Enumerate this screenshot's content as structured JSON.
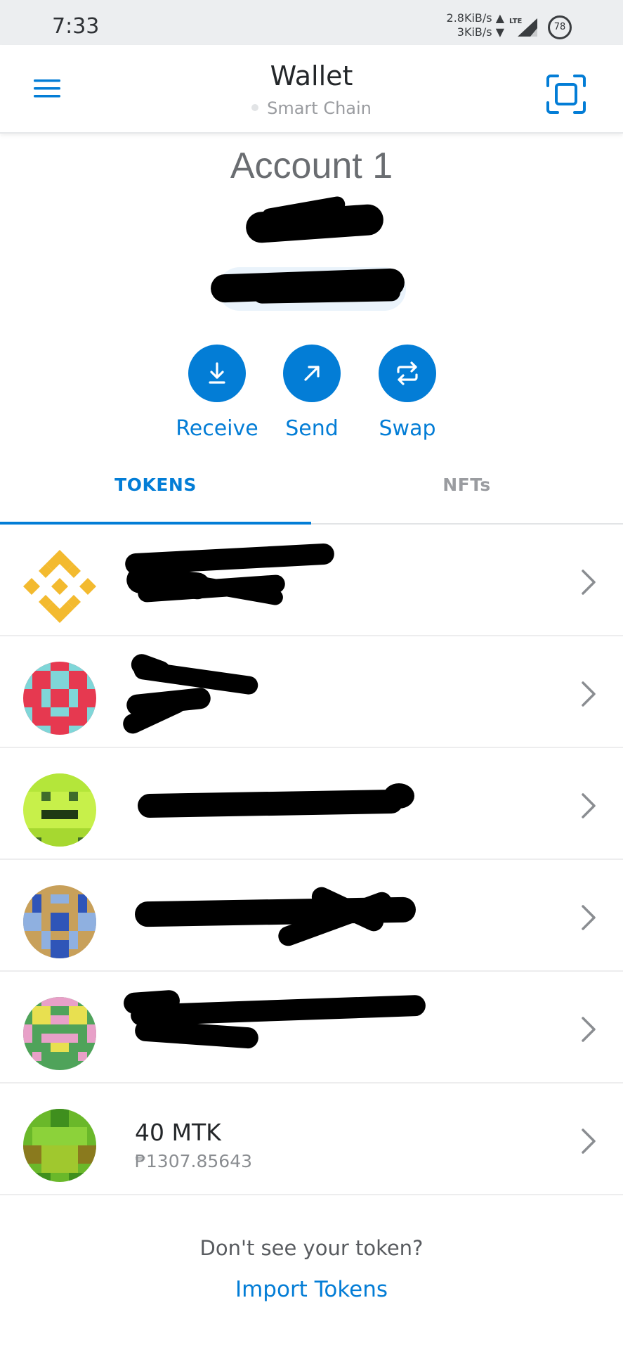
{
  "status_bar": {
    "time": "7:33",
    "upload_speed": "2.8KiB/s",
    "download_speed": "3KiB/s",
    "network_type": "LTE",
    "battery_level": "78"
  },
  "header": {
    "title": "Wallet",
    "network": "Smart Chain",
    "menu_icon": "hamburger-menu-icon",
    "scan_icon": "qr-scan-icon"
  },
  "account": {
    "name": "Account 1"
  },
  "actions": [
    {
      "label": "Receive",
      "icon": "download-arrow-icon"
    },
    {
      "label": "Send",
      "icon": "diagonal-arrow-icon"
    },
    {
      "label": "Swap",
      "icon": "swap-arrows-icon"
    }
  ],
  "tabs": [
    {
      "label": "TOKENS",
      "active": true
    },
    {
      "label": "NFTs",
      "active": false
    }
  ],
  "tokens": [
    {
      "amount": "",
      "fiat": "",
      "icon": "bnb-logo-icon"
    },
    {
      "amount": "",
      "fiat": "",
      "icon": "identicon-red-cyan"
    },
    {
      "amount": "",
      "fiat": "",
      "icon": "identicon-lime-smiley"
    },
    {
      "amount": "",
      "fiat": "",
      "icon": "identicon-blue-tan"
    },
    {
      "amount": "",
      "fiat": "",
      "icon": "identicon-green-pink"
    },
    {
      "amount": "40 MTK",
      "fiat": "₱1307.85643",
      "icon": "identicon-green-olive"
    }
  ],
  "footer": {
    "prompt": "Don't see your token?",
    "link": "Import Tokens"
  },
  "colors": {
    "accent": "#037dd6",
    "bnb_yellow": "#f3ba2f",
    "text_primary": "#24272a",
    "text_muted": "#8a8d91"
  }
}
